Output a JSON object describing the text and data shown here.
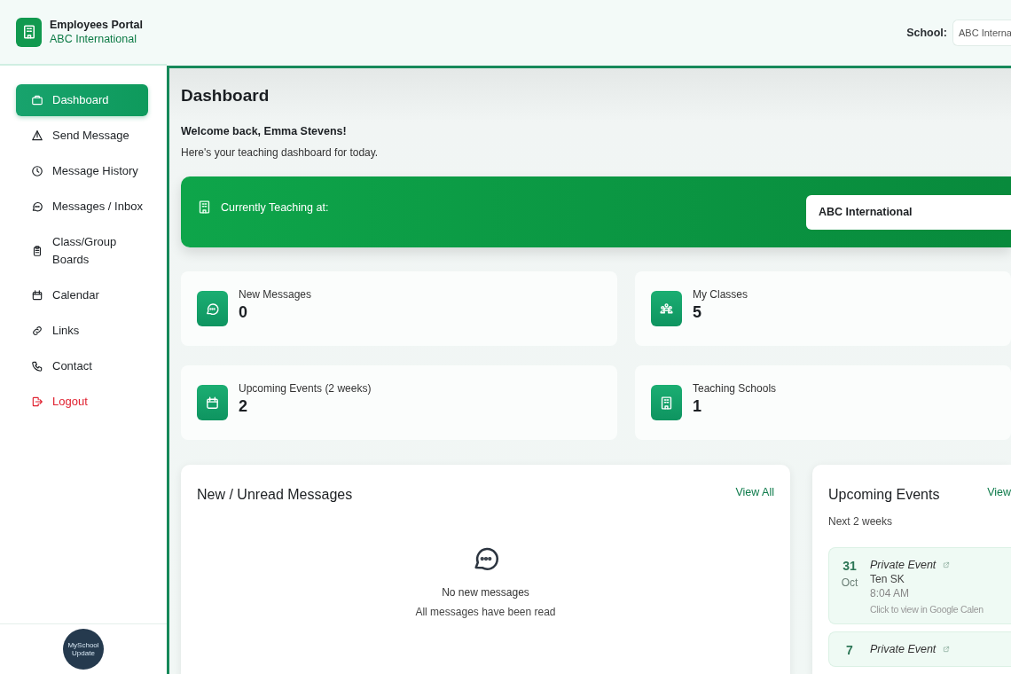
{
  "sidebar": {
    "brand": {
      "title": "Employees Portal",
      "subtitle": "ABC International"
    },
    "items": [
      {
        "label": "Dashboard",
        "kind": "nav",
        "selected": true
      },
      {
        "label": "Send Message",
        "kind": "nav",
        "selected": false
      },
      {
        "label": "Message History",
        "kind": "nav",
        "selected": false
      },
      {
        "label": "Messages / Inbox",
        "kind": "nav",
        "selected": false
      },
      {
        "label": "Class/Group Boards",
        "kind": "nav",
        "selected": false
      },
      {
        "label": "Calendar",
        "kind": "nav",
        "selected": false
      },
      {
        "label": "Links",
        "kind": "nav",
        "selected": false
      },
      {
        "label": "Contact",
        "kind": "nav",
        "selected": false
      },
      {
        "label": "Logout",
        "kind": "logout",
        "selected": false
      }
    ],
    "footer_logo": {
      "line_1": "MySchool",
      "line_2": "Update"
    }
  },
  "header": {
    "school_label": "School:",
    "school_value": "ABC Interna"
  },
  "page": {
    "title": "Dashboard",
    "welcome": "Welcome back, Emma Stevens!",
    "subtitle": "Here's your teaching dashboard for today."
  },
  "banner": {
    "label": "Currently Teaching at:",
    "school": "ABC International"
  },
  "stats": [
    {
      "label": "New Messages",
      "value": "0"
    },
    {
      "label": "My Classes",
      "value": "5"
    },
    {
      "label": "Upcoming Events (2 weeks)",
      "value": "2"
    },
    {
      "label": "Teaching Schools",
      "value": "1"
    }
  ],
  "messages_panel": {
    "title": "New / Unread Messages",
    "link": "View All",
    "empty_title": "No new messages",
    "empty_subtitle": "All messages have been read"
  },
  "events_panel": {
    "title": "Upcoming Events",
    "link": "View",
    "subtitle": "Next 2 weeks",
    "events": [
      {
        "day": "31",
        "month": "Oct",
        "title": "Private Event",
        "location": "Ten SK",
        "time": "8:04 AM",
        "hint": "Click to view in Google Calen"
      },
      {
        "day": "7",
        "title": "Private Event"
      }
    ]
  }
}
